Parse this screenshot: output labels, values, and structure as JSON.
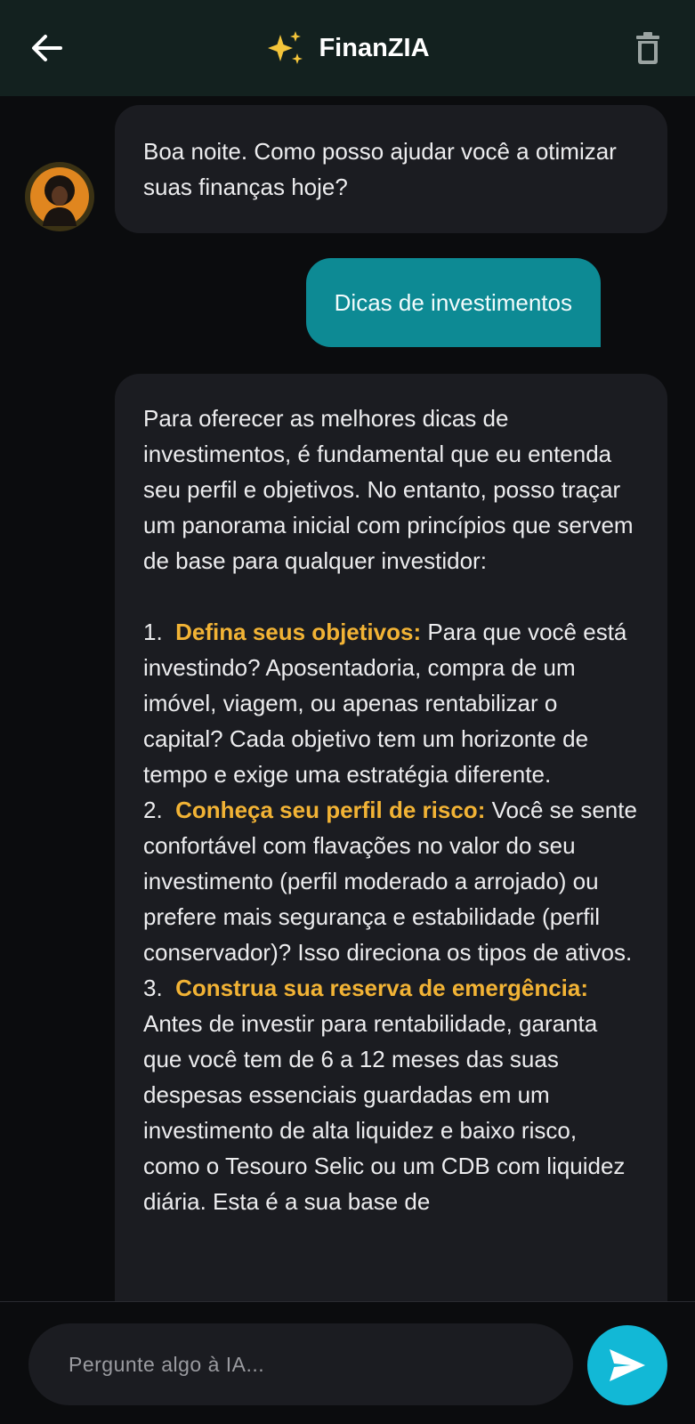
{
  "header": {
    "title": "FinanZIA",
    "back_icon": "arrow-left-icon",
    "title_icon": "sparkles-icon",
    "delete_icon": "trash-icon",
    "title_icon_color": "#F4C53A"
  },
  "messages": [
    {
      "role": "assistant",
      "text": "Boa noite. Como posso ajudar você a otimizar suas finanças hoje?"
    },
    {
      "role": "user",
      "text": "Dicas de investimentos"
    },
    {
      "role": "assistant",
      "intro": "Para oferecer as melhores dicas de investimentos, é fundamental que eu entenda seu perfil e objetivos. No entanto, posso traçar um panorama inicial com princípios que servem de base para qualquer investidor:",
      "items": [
        {
          "num": "1.",
          "title": "Defina seus objetivos:",
          "body": "Para que você está investindo? Aposentadoria, compra de um imóvel, viagem, ou apenas rentabilizar o capital? Cada objetivo tem um horizonte de tempo e exige uma estratégia diferente."
        },
        {
          "num": "2.",
          "title": "Conheça seu perfil de risco:",
          "body": "Você se sente confortável com flavações no valor do seu investimento (perfil moderado a arrojado) ou prefere mais segurança e estabilidade (perfil conservador)? Isso direciona os tipos de ativos."
        },
        {
          "num": "3.",
          "title": "Construa sua reserva de emergência:",
          "body": "Antes de investir para rentabilidade, garanta que você tem de 6 a 12 meses das suas despesas essenciais guardadas em um investimento de alta liquidez e baixo risco, como o Tesouro Selic ou um CDB com liquidez diária. Esta é a sua base de"
        }
      ]
    }
  ],
  "composer": {
    "placeholder": "Pergunte algo à IA...",
    "send_icon": "send-icon"
  },
  "colors": {
    "accent": "#12B8D6",
    "user_bubble": "#0D8A94",
    "highlight": "#F2B335",
    "header_bg": "#13211F"
  }
}
